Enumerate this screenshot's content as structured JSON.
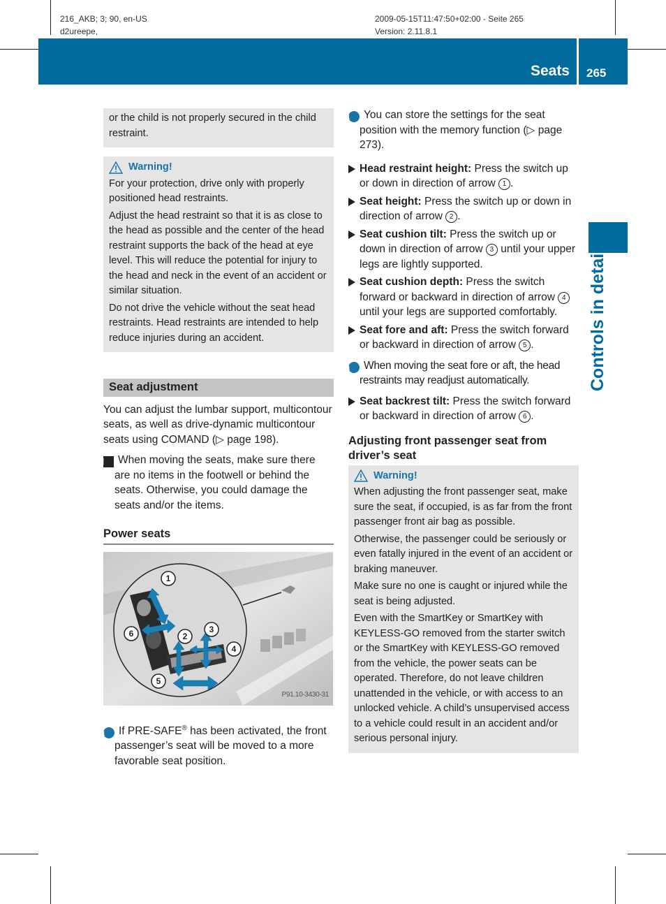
{
  "print_meta": {
    "left_line1": "216_AKB; 3; 90, en-US",
    "left_line2": "d2ureepe,",
    "right_line1": "2009-05-15T11:47:50+02:00 - Seite 265",
    "right_line2": "Version: 2.11.8.1"
  },
  "header": {
    "section_title": "Seats",
    "page_number": "265",
    "side_tab_label": "Controls in detail",
    "accent_color": "#006b9c"
  },
  "left_column": {
    "continued_box": "or the child is not properly secured in the child restraint.",
    "warning1": {
      "title": "Warning!",
      "paragraphs": [
        "For your protection, drive only with properly positioned head restraints.",
        "Adjust the head restraint so that it is as close to the head as possible and the center of the head restraint supports the back of the head at eye level. This will reduce the potential for injury to the head and neck in the event of an accident or similar situation.",
        "Do not drive the vehicle without the seat head restraints. Head restraints are intended to help reduce injuries during an accident."
      ]
    },
    "section_heading": "Seat adjustment",
    "intro": "You can adjust the lumbar support, multicontour seats, as well as drive-dynamic multicontour seats using COMAND (▷ page 198).",
    "caution_note": "When moving the seats, make sure there are no items in the footwell or behind the seats. Otherwise, you could damage the seats and/or the items.",
    "subheading": "Power seats",
    "figure": {
      "code": "P91.10-3430-31",
      "callouts": [
        "1",
        "2",
        "3",
        "4",
        "5",
        "6"
      ]
    },
    "info_note": {
      "prefix": "If PRE-SAFE",
      "sup": "®",
      "suffix": " has been activated, the front passenger’s seat will be moved to a more favorable seat position."
    }
  },
  "right_column": {
    "info_memory": "You can store the settings for the seat position with the memory function (▷ page 273).",
    "steps_a": [
      {
        "label": "Head restraint height:",
        "text": " Press the switch up or down in direction of arrow ",
        "num": "1",
        "end": "."
      },
      {
        "label": "Seat height:",
        "text": " Press the switch up or down in direction of arrow ",
        "num": "2",
        "end": "."
      },
      {
        "label": "Seat cushion tilt:",
        "text": " Press the switch up or down in direction of arrow ",
        "num": "3",
        "end": " until your upper legs are lightly supported."
      },
      {
        "label": "Seat cushion depth:",
        "text": " Press the switch forward or backward in direction of arrow ",
        "num": "4",
        "end": " until your legs are supported comfortably."
      },
      {
        "label": "Seat fore and aft:",
        "text": " Press the switch forward or backward in direction of arrow ",
        "num": "5",
        "end": "."
      }
    ],
    "info_fore_aft": "When moving the seat fore or aft, the head restraints may readjust automatically.",
    "steps_b": [
      {
        "label": "Seat backrest tilt:",
        "text": " Press the switch forward or backward in direction of arrow ",
        "num": "6",
        "end": "."
      }
    ],
    "subheading": "Adjusting front passenger seat from driver’s seat",
    "warning2": {
      "title": "Warning!",
      "paragraphs": [
        "When adjusting the front passenger seat, make sure the seat, if occupied, is as far from the front passenger front air bag as possible.",
        "Otherwise, the passenger could be seriously or even fatally injured in the event of an accident or braking maneuver.",
        "Make sure no one is caught or injured while the seat is being adjusted.",
        "Even with the SmartKey or SmartKey with KEYLESS-GO removed from the starter switch or the SmartKey with KEYLESS-GO removed from the vehicle, the power seats can be operated. Therefore, do not leave children unattended in the vehicle, or with access to an unlocked vehicle. A child’s unsupervised access to a vehicle could result in an accident and/or serious personal injury."
      ]
    }
  }
}
